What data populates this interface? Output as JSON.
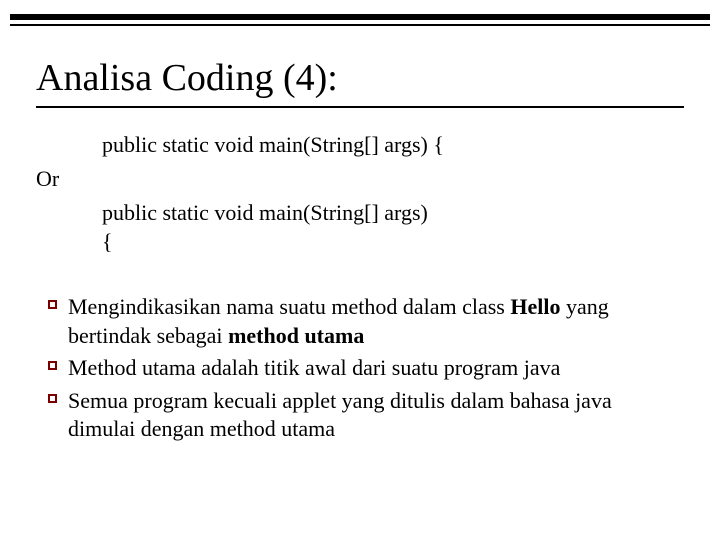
{
  "title": "Analisa Coding (4):",
  "code_line_1": "public static void main(String[] args) {",
  "or_label": "Or",
  "code_line_2a": "public static void main(String[] args)",
  "code_line_2b": "{",
  "bullets": [
    {
      "pre": "Mengindikasikan nama suatu method dalam class ",
      "bold1": "Hello",
      "mid": " yang bertindak sebagai ",
      "bold2": "method utama",
      "post": ""
    },
    {
      "pre": "Method utama adalah titik awal dari suatu program java",
      "bold1": "",
      "mid": "",
      "bold2": "",
      "post": ""
    },
    {
      "pre": "Semua program kecuali applet yang ditulis dalam bahasa java dimulai dengan method utama",
      "bold1": "",
      "mid": "",
      "bold2": "",
      "post": ""
    }
  ]
}
